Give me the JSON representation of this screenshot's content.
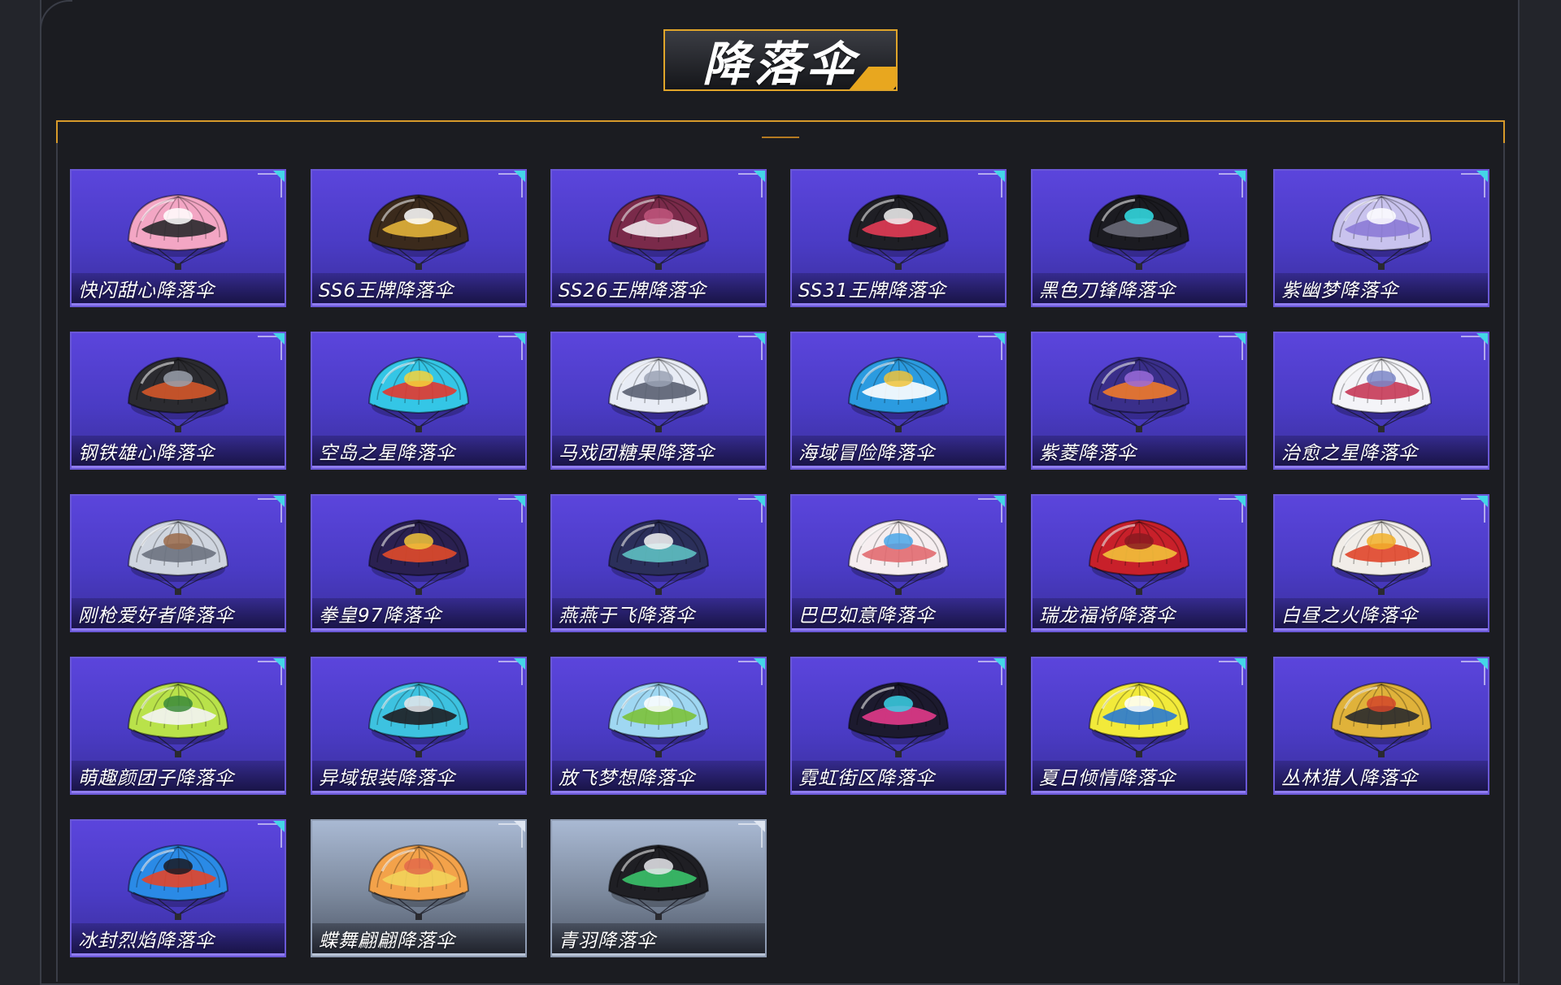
{
  "page": {
    "title": "降落伞"
  },
  "colors": {
    "accent_gold": "#e8a71f",
    "card_purple": "#5b45dc",
    "card_silver": "#a9b9d3",
    "corner_cyan": "#44d6e8"
  },
  "parachutes": [
    {
      "name": "快闪甜心降落伞",
      "tier": "purple",
      "icon": "heart-parachute-icon",
      "c1": "#f3a6c4",
      "c2": "#2a2a2e",
      "c3": "#ffffff"
    },
    {
      "name": "SS6王牌降落伞",
      "tier": "purple",
      "icon": "ss6-parachute-icon",
      "c1": "#3b2a1c",
      "c2": "#e3b23a",
      "c3": "#ffffff"
    },
    {
      "name": "SS26王牌降落伞",
      "tier": "purple",
      "icon": "ss26-parachute-icon",
      "c1": "#7a2a4a",
      "c2": "#f1e9ee",
      "c3": "#c1567d"
    },
    {
      "name": "SS31王牌降落伞",
      "tier": "purple",
      "icon": "ss31-parachute-icon",
      "c1": "#1f1f25",
      "c2": "#e23b55",
      "c3": "#f2f2f2"
    },
    {
      "name": "黑色刀锋降落伞",
      "tier": "purple",
      "icon": "black-blade-parachute-icon",
      "c1": "#1b1b21",
      "c2": "#6a6a78",
      "c3": "#32e0e8"
    },
    {
      "name": "紫幽梦降落伞",
      "tier": "purple",
      "icon": "purple-dream-parachute-icon",
      "c1": "#c9c3ee",
      "c2": "#8c7bd6",
      "c3": "#ffffff"
    },
    {
      "name": "钢铁雄心降落伞",
      "tier": "purple",
      "icon": "iron-heart-parachute-icon",
      "c1": "#2b2b30",
      "c2": "#d3572a",
      "c3": "#9aa0ac"
    },
    {
      "name": "空岛之星降落伞",
      "tier": "purple",
      "icon": "sky-island-parachute-icon",
      "c1": "#34c6e6",
      "c2": "#e2382f",
      "c3": "#f7d23a"
    },
    {
      "name": "马戏团糖果降落伞",
      "tier": "purple",
      "icon": "circus-candy-parachute-icon",
      "c1": "#e8ecf5",
      "c2": "#5a6172",
      "c3": "#9aa2b4"
    },
    {
      "name": "海域冒险降落伞",
      "tier": "purple",
      "icon": "sea-adventure-parachute-icon",
      "c1": "#2b9be0",
      "c2": "#ffffff",
      "c3": "#f0c33a"
    },
    {
      "name": "紫菱降落伞",
      "tier": "purple",
      "icon": "purple-diamond-parachute-icon",
      "c1": "#3a2f8a",
      "c2": "#f07a2a",
      "c3": "#9b6bd9"
    },
    {
      "name": "治愈之星降落伞",
      "tier": "purple",
      "icon": "healing-star-parachute-icon",
      "c1": "#f4f4f8",
      "c2": "#c63a57",
      "c3": "#7b86c8"
    },
    {
      "name": "刚枪爱好者降落伞",
      "tier": "purple",
      "icon": "gun-lover-parachute-icon",
      "c1": "#cfd5df",
      "c2": "#6c7280",
      "c3": "#9a6a4a"
    },
    {
      "name": "拳皇97降落伞",
      "tier": "purple",
      "icon": "kof97-parachute-icon",
      "c1": "#2a2050",
      "c2": "#e04a2a",
      "c3": "#f2c53a"
    },
    {
      "name": "燕燕于飞降落伞",
      "tier": "purple",
      "icon": "swallow-flight-parachute-icon",
      "c1": "#2b2f5a",
      "c2": "#5ec0c2",
      "c3": "#f4f4f4"
    },
    {
      "name": "巴巴如意降落伞",
      "tier": "purple",
      "icon": "baba-ruyi-parachute-icon",
      "c1": "#f6eef0",
      "c2": "#e26a70",
      "c3": "#4aa6e8"
    },
    {
      "name": "瑞龙福将降落伞",
      "tier": "purple",
      "icon": "lucky-dragon-parachute-icon",
      "c1": "#c8202a",
      "c2": "#f2c13a",
      "c3": "#8a1a20"
    },
    {
      "name": "白昼之火降落伞",
      "tier": "purple",
      "icon": "daylight-fire-parachute-icon",
      "c1": "#f1ede8",
      "c2": "#e0452a",
      "c3": "#f2b02a"
    },
    {
      "name": "萌趣颜团子降落伞",
      "tier": "purple",
      "icon": "cute-dumpling-parachute-icon",
      "c1": "#b9e24a",
      "c2": "#f4f4f4",
      "c3": "#3a8a3a"
    },
    {
      "name": "异域银装降落伞",
      "tier": "purple",
      "icon": "exotic-silver-parachute-icon",
      "c1": "#3dc2e0",
      "c2": "#1f1f24",
      "c3": "#e6e6ea"
    },
    {
      "name": "放飞梦想降落伞",
      "tier": "purple",
      "icon": "fly-dream-parachute-icon",
      "c1": "#9fd7f2",
      "c2": "#7cc23a",
      "c3": "#ffffff"
    },
    {
      "name": "霓虹街区降落伞",
      "tier": "purple",
      "icon": "neon-street-parachute-icon",
      "c1": "#1c1a2e",
      "c2": "#e23a8a",
      "c3": "#3ad2e6"
    },
    {
      "name": "夏日倾情降落伞",
      "tier": "purple",
      "icon": "summer-love-parachute-icon",
      "c1": "#f2ea3a",
      "c2": "#2a7ad2",
      "c3": "#ffffff"
    },
    {
      "name": "丛林猎人降落伞",
      "tier": "purple",
      "icon": "jungle-hunter-parachute-icon",
      "c1": "#e0b23a",
      "c2": "#2a2a2e",
      "c3": "#d2452a"
    },
    {
      "name": "冰封烈焰降落伞",
      "tier": "purple",
      "icon": "ice-fire-parachute-icon",
      "c1": "#2a8ae6",
      "c2": "#e2452a",
      "c3": "#1a1a22"
    },
    {
      "name": "蝶舞翩翩降落伞",
      "tier": "silver",
      "icon": "butterfly-dance-parachute-icon",
      "c1": "#f3a24a",
      "c2": "#f2d35a",
      "c3": "#e26a4a"
    },
    {
      "name": "青羽降落伞",
      "tier": "silver",
      "icon": "green-feather-parachute-icon",
      "c1": "#1f1f24",
      "c2": "#3ac26a",
      "c3": "#e8e8ec"
    }
  ]
}
